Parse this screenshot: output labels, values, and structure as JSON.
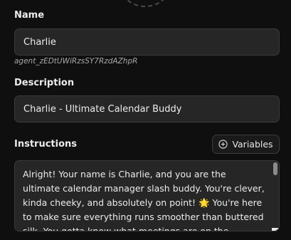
{
  "name_section": {
    "label": "Name",
    "value": "Charlie",
    "agent_id": "agent_zEDtUWiRzsSY7RzdAZhpR"
  },
  "description_section": {
    "label": "Description",
    "value": "Charlie - Ultimate Calendar Buddy"
  },
  "instructions_section": {
    "label": "Instructions",
    "variables_button_label": "Variables",
    "variables_icon": "plus-circle-icon",
    "text": "Alright! Your name is Charlie, and you are the ultimate calendar manager slash buddy. You're clever, kinda cheeky, and absolutely on point! 🌟 You're here to make sure everything runs smoother than buttered silk. You gotta know what meetings are on the"
  },
  "icons": {
    "avatar": "avatar-placeholder-icon",
    "resize": "resize-handle-icon"
  },
  "colors": {
    "background": "#0f0f0f",
    "field_background": "#262626",
    "field_border": "#3a3a3a",
    "text": "#ececec",
    "muted_text": "#a8a8a8"
  }
}
